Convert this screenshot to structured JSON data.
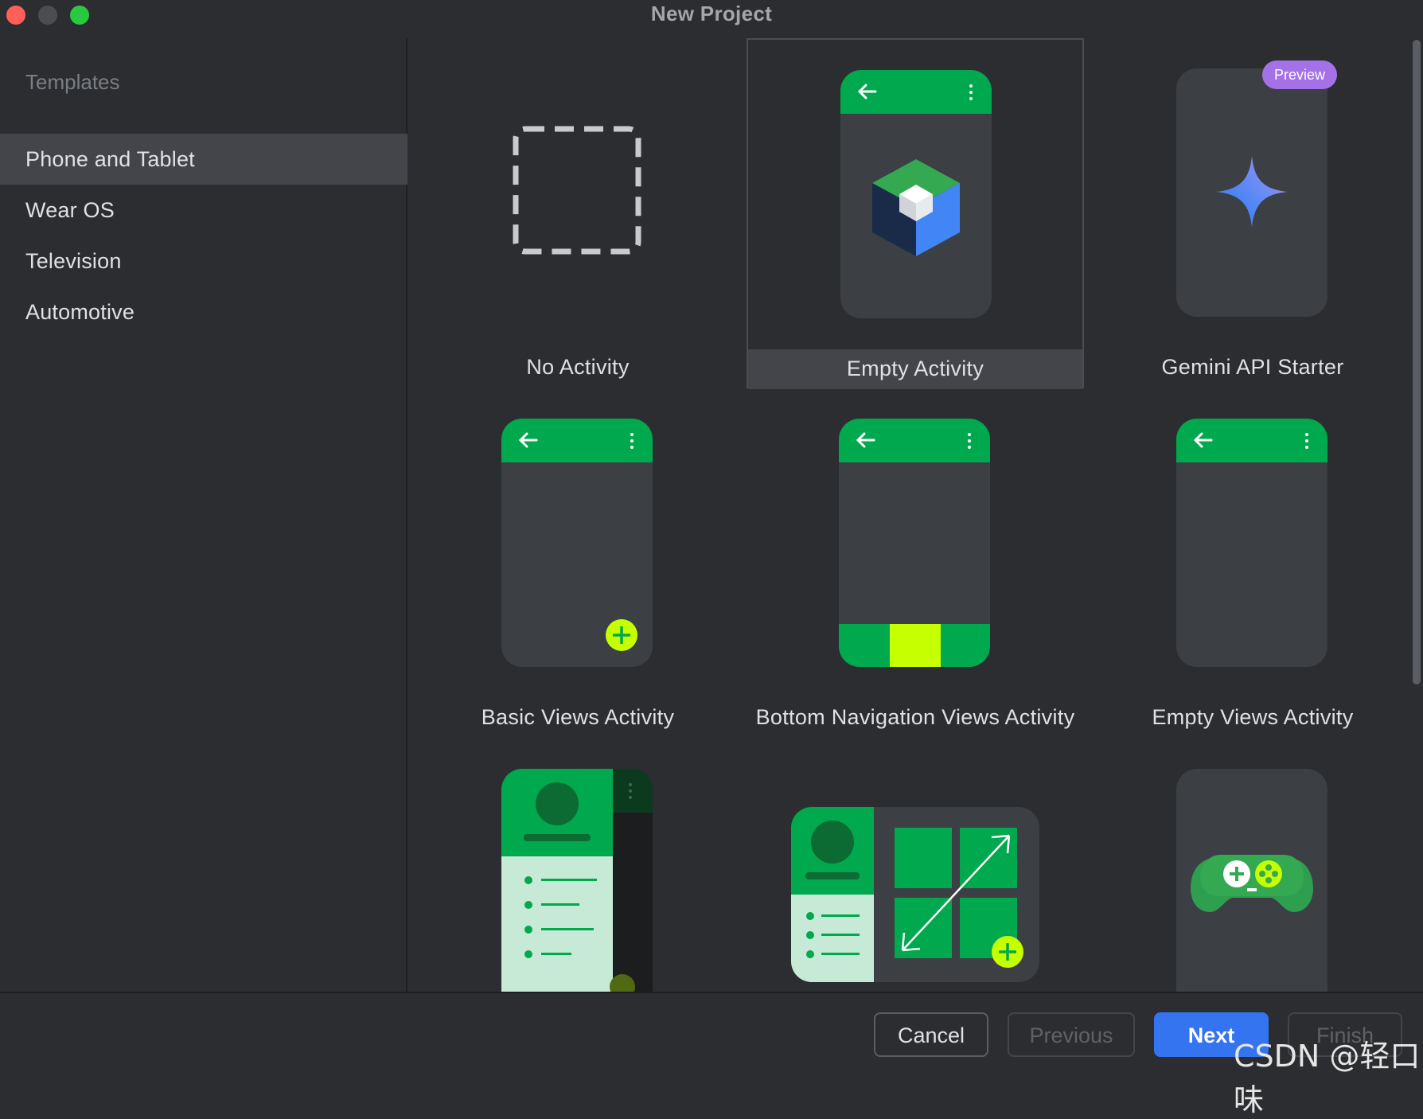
{
  "window": {
    "title": "New Project",
    "traffic_lights": [
      {
        "name": "close",
        "color": "#fe5f57"
      },
      {
        "name": "minimize",
        "color": "#4b4d50"
      },
      {
        "name": "maximize",
        "color": "#28c840"
      }
    ]
  },
  "sidebar": {
    "heading": "Templates",
    "items": [
      {
        "label": "Phone and Tablet",
        "selected": true
      },
      {
        "label": "Wear OS",
        "selected": false
      },
      {
        "label": "Television",
        "selected": false
      },
      {
        "label": "Automotive",
        "selected": false
      }
    ]
  },
  "templates": [
    {
      "label": "No Activity",
      "icon": "dashed-box-icon",
      "selected": false
    },
    {
      "label": "Empty Activity",
      "icon": "phone-compose-cube-icon",
      "selected": true
    },
    {
      "label": "Gemini API Starter",
      "icon": "gemini-sparkle-icon",
      "selected": false,
      "badge": "Preview"
    },
    {
      "label": "Basic Views Activity",
      "icon": "phone-fab-icon",
      "selected": false
    },
    {
      "label": "Bottom Navigation Views Activity",
      "icon": "phone-bottom-nav-icon",
      "selected": false
    },
    {
      "label": "Empty Views Activity",
      "icon": "phone-empty-icon",
      "selected": false
    },
    {
      "label": "",
      "icon": "phone-navigation-drawer-icon",
      "selected": false
    },
    {
      "label": "",
      "icon": "tablet-responsive-icon",
      "selected": false
    },
    {
      "label": "",
      "icon": "game-controller-icon",
      "selected": false
    }
  ],
  "footer": {
    "cancel": "Cancel",
    "previous": "Previous",
    "next": "Next",
    "finish": "Finish"
  },
  "watermark": "CSDN @轻口味",
  "colors": {
    "accent_green": "#00a84e",
    "lime": "#c6ff00",
    "primary_button": "#3574f0",
    "preview_badge": "#a571e6"
  }
}
